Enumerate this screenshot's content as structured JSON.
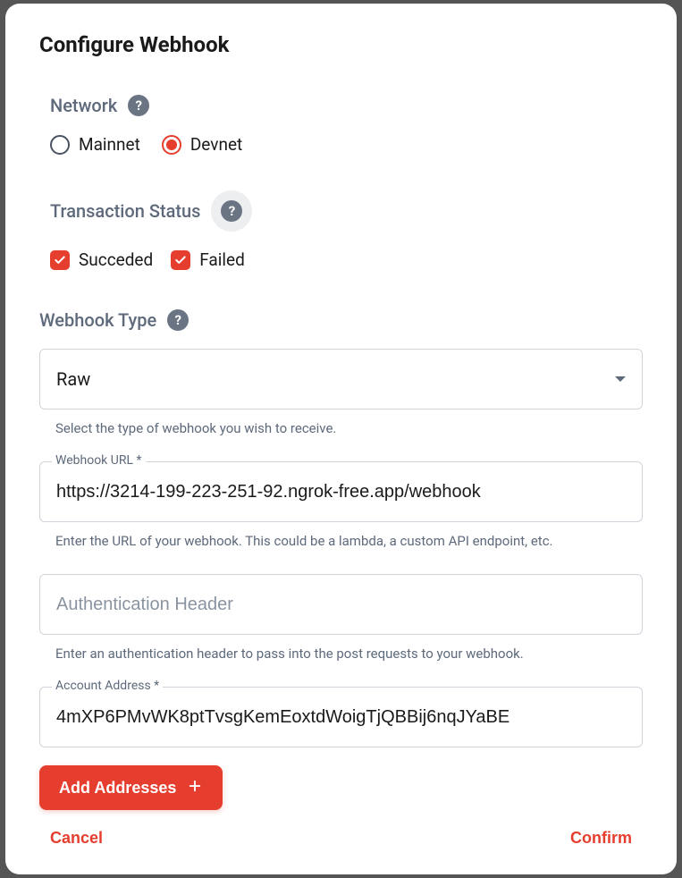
{
  "modal": {
    "title": "Configure Webhook"
  },
  "network": {
    "label": "Network",
    "options": {
      "mainnet": "Mainnet",
      "devnet": "Devnet"
    },
    "selected": "devnet"
  },
  "transaction_status": {
    "label": "Transaction Status",
    "options": {
      "succeeded": "Succeded",
      "failed": "Failed"
    },
    "checked": {
      "succeeded": true,
      "failed": true
    }
  },
  "webhook_type": {
    "label": "Webhook Type",
    "value": "Raw",
    "helper": "Select the type of webhook you wish to receive."
  },
  "webhook_url": {
    "label": "Webhook URL *",
    "value": "https://3214-199-223-251-92.ngrok-free.app/webhook",
    "helper": "Enter the URL of your webhook. This could be a lambda, a custom API endpoint, etc."
  },
  "auth_header": {
    "placeholder": "Authentication Header",
    "value": "",
    "helper": "Enter an authentication header to pass into the post requests to your webhook."
  },
  "account_address": {
    "label": "Account Address *",
    "value": "4mXP6PMvWK8ptTvsgKemEoxtdWoigTjQBBij6nqJYaBE"
  },
  "buttons": {
    "add_addresses": "Add Addresses",
    "cancel": "Cancel",
    "confirm": "Confirm"
  }
}
